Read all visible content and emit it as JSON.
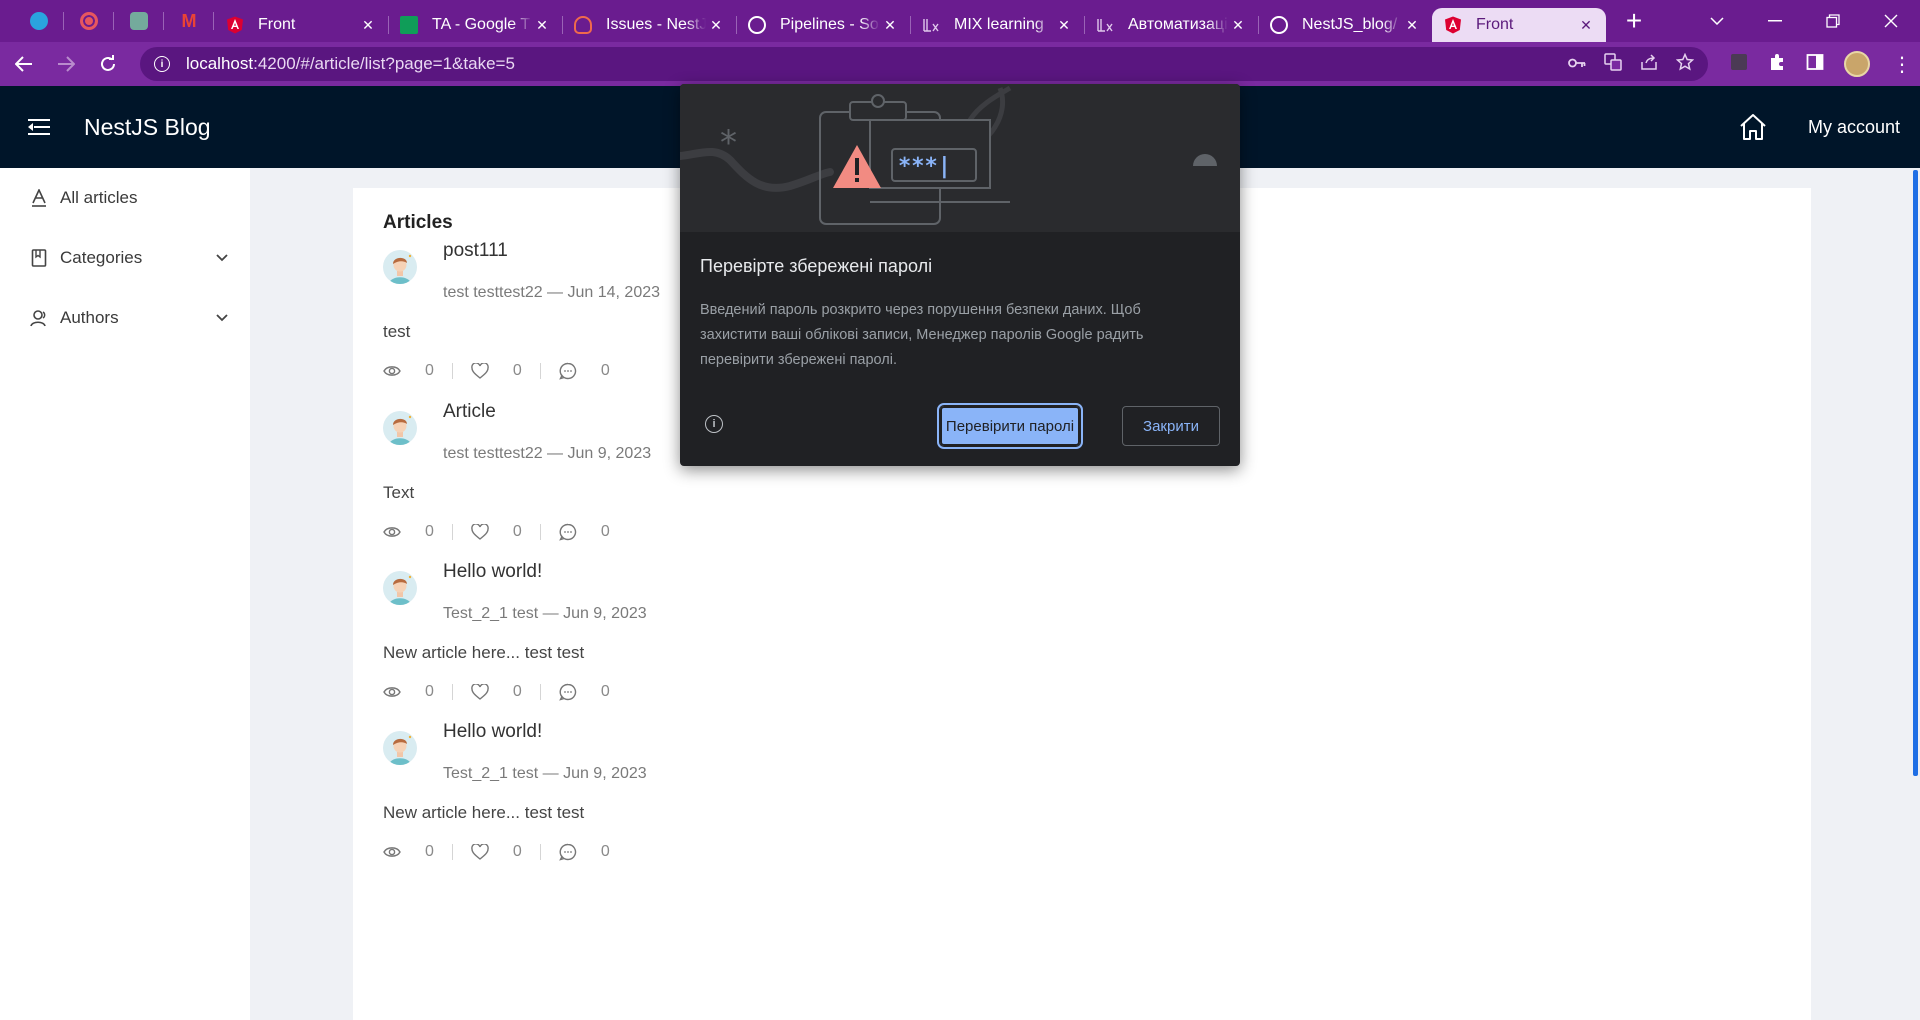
{
  "browser": {
    "pinned_tabs": [
      {
        "icon": "telegram-icon",
        "color": "#2aa3df"
      },
      {
        "icon": "record-icon",
        "color": "#e8575e"
      },
      {
        "icon": "chatgpt-icon",
        "color": "#74aa9c"
      },
      {
        "icon": "gmail-icon",
        "color": "#ea4335"
      }
    ],
    "tabs": [
      {
        "title": "Front",
        "icon": "angular-icon",
        "color": "#dd0031",
        "active": false
      },
      {
        "title": "TA - Google T",
        "icon": "google-sheets-icon",
        "color": "#0f9d58",
        "active": false
      },
      {
        "title": "Issues - NestJ",
        "icon": "cloud-icon",
        "color": "#f06a4c",
        "active": false
      },
      {
        "title": "Pipelines - So",
        "icon": "pipelines-icon",
        "color": "#ffffff",
        "active": false
      },
      {
        "title": "MIX learning",
        "icon": "mix-icon",
        "color": "#e0c8ec",
        "active": false
      },
      {
        "title": "Автоматизаці",
        "icon": "mix-icon",
        "color": "#e0c8ec",
        "active": false
      },
      {
        "title": "NestJS_blog/",
        "icon": "github-icon",
        "color": "#ffffff",
        "active": false
      },
      {
        "title": "Front",
        "icon": "angular-icon",
        "color": "#dd0031",
        "active": true
      }
    ],
    "url_host": "localhost",
    "url_rest": ":4200/#/article/list?page=1&take=5"
  },
  "app": {
    "brand": "NestJS Blog",
    "my_account": "My account",
    "sidebar": [
      {
        "label": "All articles",
        "icon": "articles-icon",
        "has_chevron": false
      },
      {
        "label": "Categories",
        "icon": "bookmark-icon",
        "has_chevron": true
      },
      {
        "label": "Authors",
        "icon": "users-icon",
        "has_chevron": true
      }
    ],
    "heading": "Articles",
    "articles": [
      {
        "title": "post111",
        "meta": "test testtest22 — Jun 14, 2023",
        "body": "test",
        "views": "0",
        "likes": "0",
        "comments": "0"
      },
      {
        "title": "Article",
        "meta": "test testtest22 — Jun 9, 2023",
        "body": "Text",
        "views": "0",
        "likes": "0",
        "comments": "0"
      },
      {
        "title": "Hello world!",
        "meta": "Test_2_1 test — Jun 9, 2023",
        "body": "New article here... test test",
        "views": "0",
        "likes": "0",
        "comments": "0"
      },
      {
        "title": "Hello world!",
        "meta": "Test_2_1 test — Jun 9, 2023",
        "body": "New article here... test test",
        "views": "0",
        "likes": "0",
        "comments": "0"
      }
    ]
  },
  "password_dialog": {
    "title": "Перевірте збережені паролі",
    "text": "Введений пароль розкрито через порушення безпеки даних. Щоб захистити ваші облікові записи, Менеджер паролів Google радить перевірити збережені паролі.",
    "primary": "Перевірити паролі",
    "secondary": "Закрити",
    "illustration_password": "***|"
  },
  "colors": {
    "tab_strip": "#6a1c8f",
    "toolbar": "#7a2aa0",
    "header": "#001529",
    "dialog_bg": "#202124",
    "dialog_accent": "#8ab4f8"
  }
}
